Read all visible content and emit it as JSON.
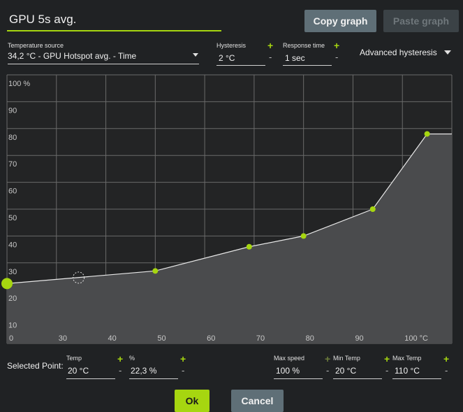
{
  "header": {
    "title_value": "GPU 5s avg.",
    "copy_label": "Copy graph",
    "paste_label": "Paste graph"
  },
  "controls": {
    "temp_source_label": "Temperature source",
    "temp_source_value": "34,2 °C - GPU Hotspot avg. - Time",
    "hysteresis_label": "Hysteresis",
    "hysteresis_value": "2 °C",
    "response_label": "Response time",
    "response_value": "1 sec",
    "advanced_label": "Advanced hysteresis",
    "plus": "+",
    "minus": "-"
  },
  "chart_data": {
    "type": "line",
    "x_ticks": [
      "0",
      "30",
      "40",
      "50",
      "60",
      "70",
      "80",
      "90",
      "100 °C"
    ],
    "y_ticks": [
      "10",
      "20",
      "30",
      "40",
      "50",
      "60",
      "70",
      "80",
      "90",
      "100 %"
    ],
    "xlim": [
      20,
      110
    ],
    "ylim": [
      0,
      100
    ],
    "grid": true,
    "points": [
      {
        "x": 20,
        "y": 22.3
      },
      {
        "x": 50,
        "y": 27
      },
      {
        "x": 69,
        "y": 36
      },
      {
        "x": 80,
        "y": 40
      },
      {
        "x": 94,
        "y": 50
      },
      {
        "x": 105,
        "y": 78
      },
      {
        "x": 110,
        "y": 78
      }
    ],
    "selected_point": {
      "x": 20,
      "y": 22.3
    },
    "hover_point": {
      "x": 34.5,
      "y": 24.5
    },
    "colors": {
      "point": "#a6d610",
      "line": "#e8e8e8",
      "fill": "#4a4b4d",
      "grid": "#6a6a6a",
      "background": "#232425"
    }
  },
  "selected": {
    "label": "Selected Point:",
    "temp_label": "Temp",
    "temp_value": "20 °C",
    "pct_label": "%",
    "pct_value": "22,3 %",
    "max_speed_label": "Max speed",
    "max_speed_value": "100 %",
    "min_temp_label": "Min Temp",
    "min_temp_value": "20 °C",
    "max_temp_label": "Max Temp",
    "max_temp_value": "110 °C"
  },
  "footer": {
    "ok_label": "Ok",
    "cancel_label": "Cancel"
  },
  "colors": {
    "accent": "#a6d610",
    "button": "#5f6f77",
    "button_disabled": "#3b4246",
    "background": "#202224"
  }
}
